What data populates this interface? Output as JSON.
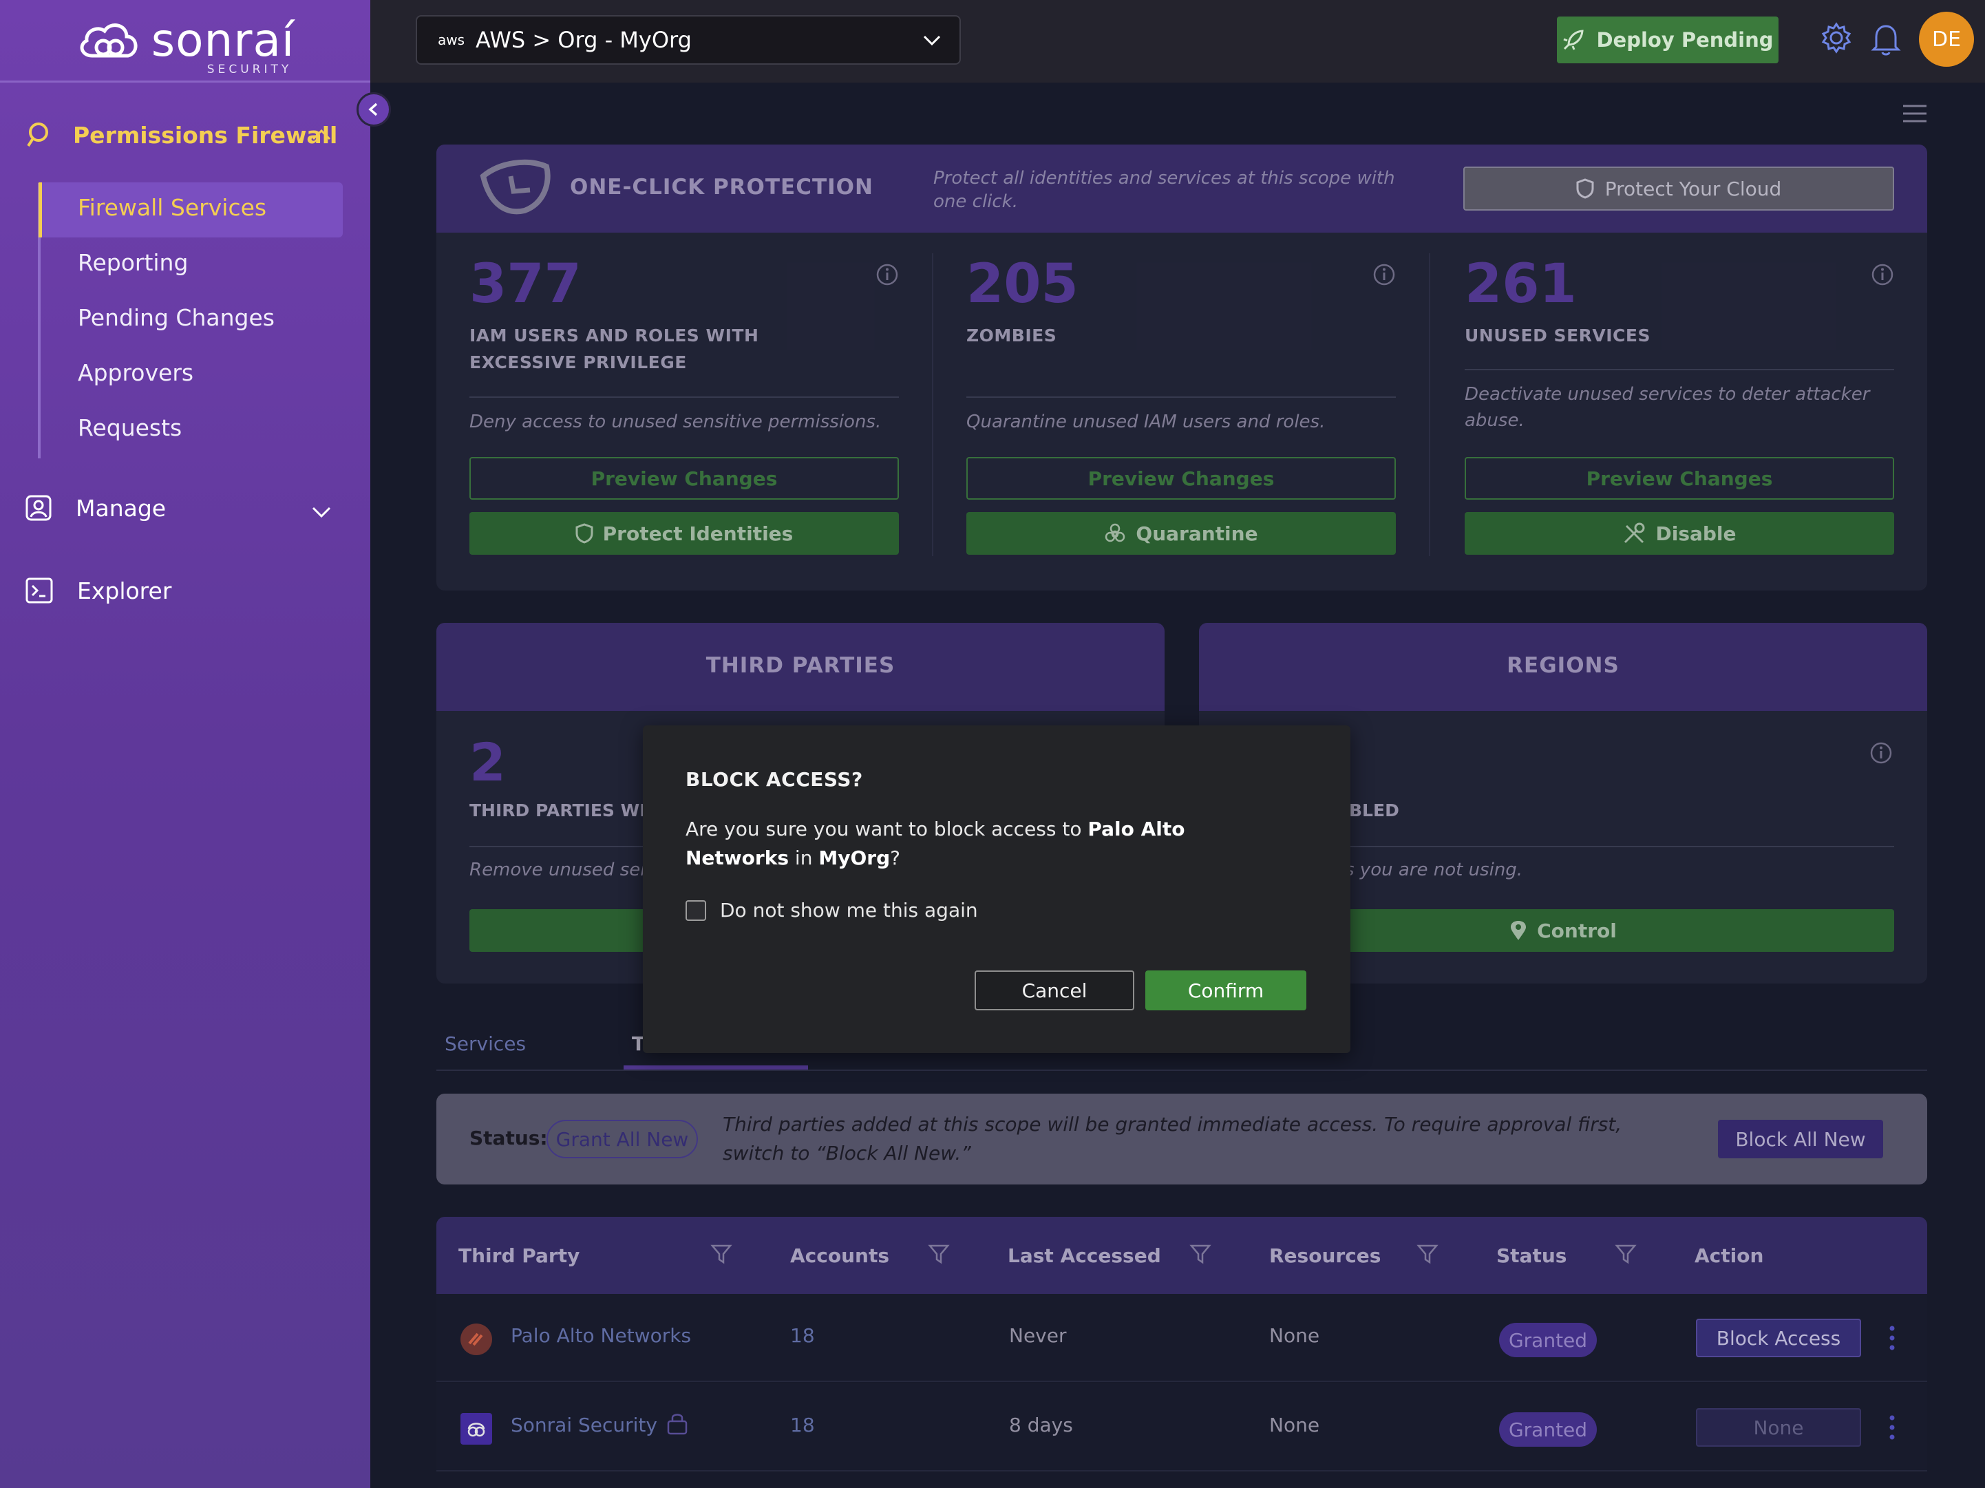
{
  "brand": {
    "name": "sonraí",
    "sub": "SECURITY"
  },
  "sidebar": {
    "permissions_firewall": "Permissions Firewall",
    "items": [
      "Firewall Services",
      "Reporting",
      "Pending Changes",
      "Approvers",
      "Requests"
    ],
    "manage": "Manage",
    "explorer": "Explorer"
  },
  "topbar": {
    "scope_provider": "aws",
    "scope": "AWS > Org - MyOrg",
    "deploy": "Deploy Pending",
    "avatar": "DE"
  },
  "oneclick": {
    "title": "ONE-CLICK PROTECTION",
    "desc": "Protect all identities and services at this scope with one click.",
    "button": "Protect Your Cloud"
  },
  "stats": [
    {
      "value": "377",
      "label": "IAM USERS AND ROLES WITH EXCESSIVE PRIVILEGE",
      "desc": "Deny access to unused sensitive permissions.",
      "preview": "Preview Changes",
      "action": "Protect Identities"
    },
    {
      "value": "205",
      "label": "ZOMBIES",
      "desc": "Quarantine unused IAM users and roles.",
      "preview": "Preview Changes",
      "action": "Quarantine"
    },
    {
      "value": "261",
      "label": "UNUSED SERVICES",
      "desc": "Deactivate unused services to deter attacker abuse.",
      "preview": "Preview Changes",
      "action": "Disable"
    }
  ],
  "third_parties": {
    "title": "THIRD PARTIES",
    "value": "2",
    "label_partial": "THIRD PARTIES WITH",
    "desc_partial": "Remove unused sens"
  },
  "regions": {
    "title": "REGIONS",
    "label_partial": "BLED",
    "desc_partial": "s you are not using.",
    "action": "Control"
  },
  "tabs": {
    "services": "Services",
    "third_parties_partial": "T"
  },
  "status_bar": {
    "label": "Status:",
    "pill": "Grant All New",
    "desc": "Third parties added at this scope will be granted immediate access. To require approval first, switch to “Block All New.”",
    "button": "Block All New"
  },
  "table": {
    "headers": [
      "Third Party",
      "Accounts",
      "Last Accessed",
      "Resources",
      "Status",
      "Action"
    ],
    "rows": [
      {
        "name": "Palo Alto Networks",
        "accounts": "18",
        "last": "Never",
        "resources": "None",
        "status": "Granted",
        "action": "Block Access"
      },
      {
        "name": "Sonrai Security",
        "accounts": "18",
        "last": "8 days",
        "resources": "None",
        "status": "Granted",
        "action": "None"
      }
    ]
  },
  "modal": {
    "title": "BLOCK ACCESS?",
    "text_pre": "Are you sure you want to block access to ",
    "target": "Palo Alto Networks",
    "text_mid": " in ",
    "scope": "MyOrg",
    "text_post": "?",
    "checkbox": "Do not show me this again",
    "cancel": "Cancel",
    "confirm": "Confirm"
  },
  "colors": {
    "accent": "#f4ce52",
    "brand_purple": "#6a3fb0",
    "success": "#3d8b3a",
    "avatar": "#e5901f"
  }
}
